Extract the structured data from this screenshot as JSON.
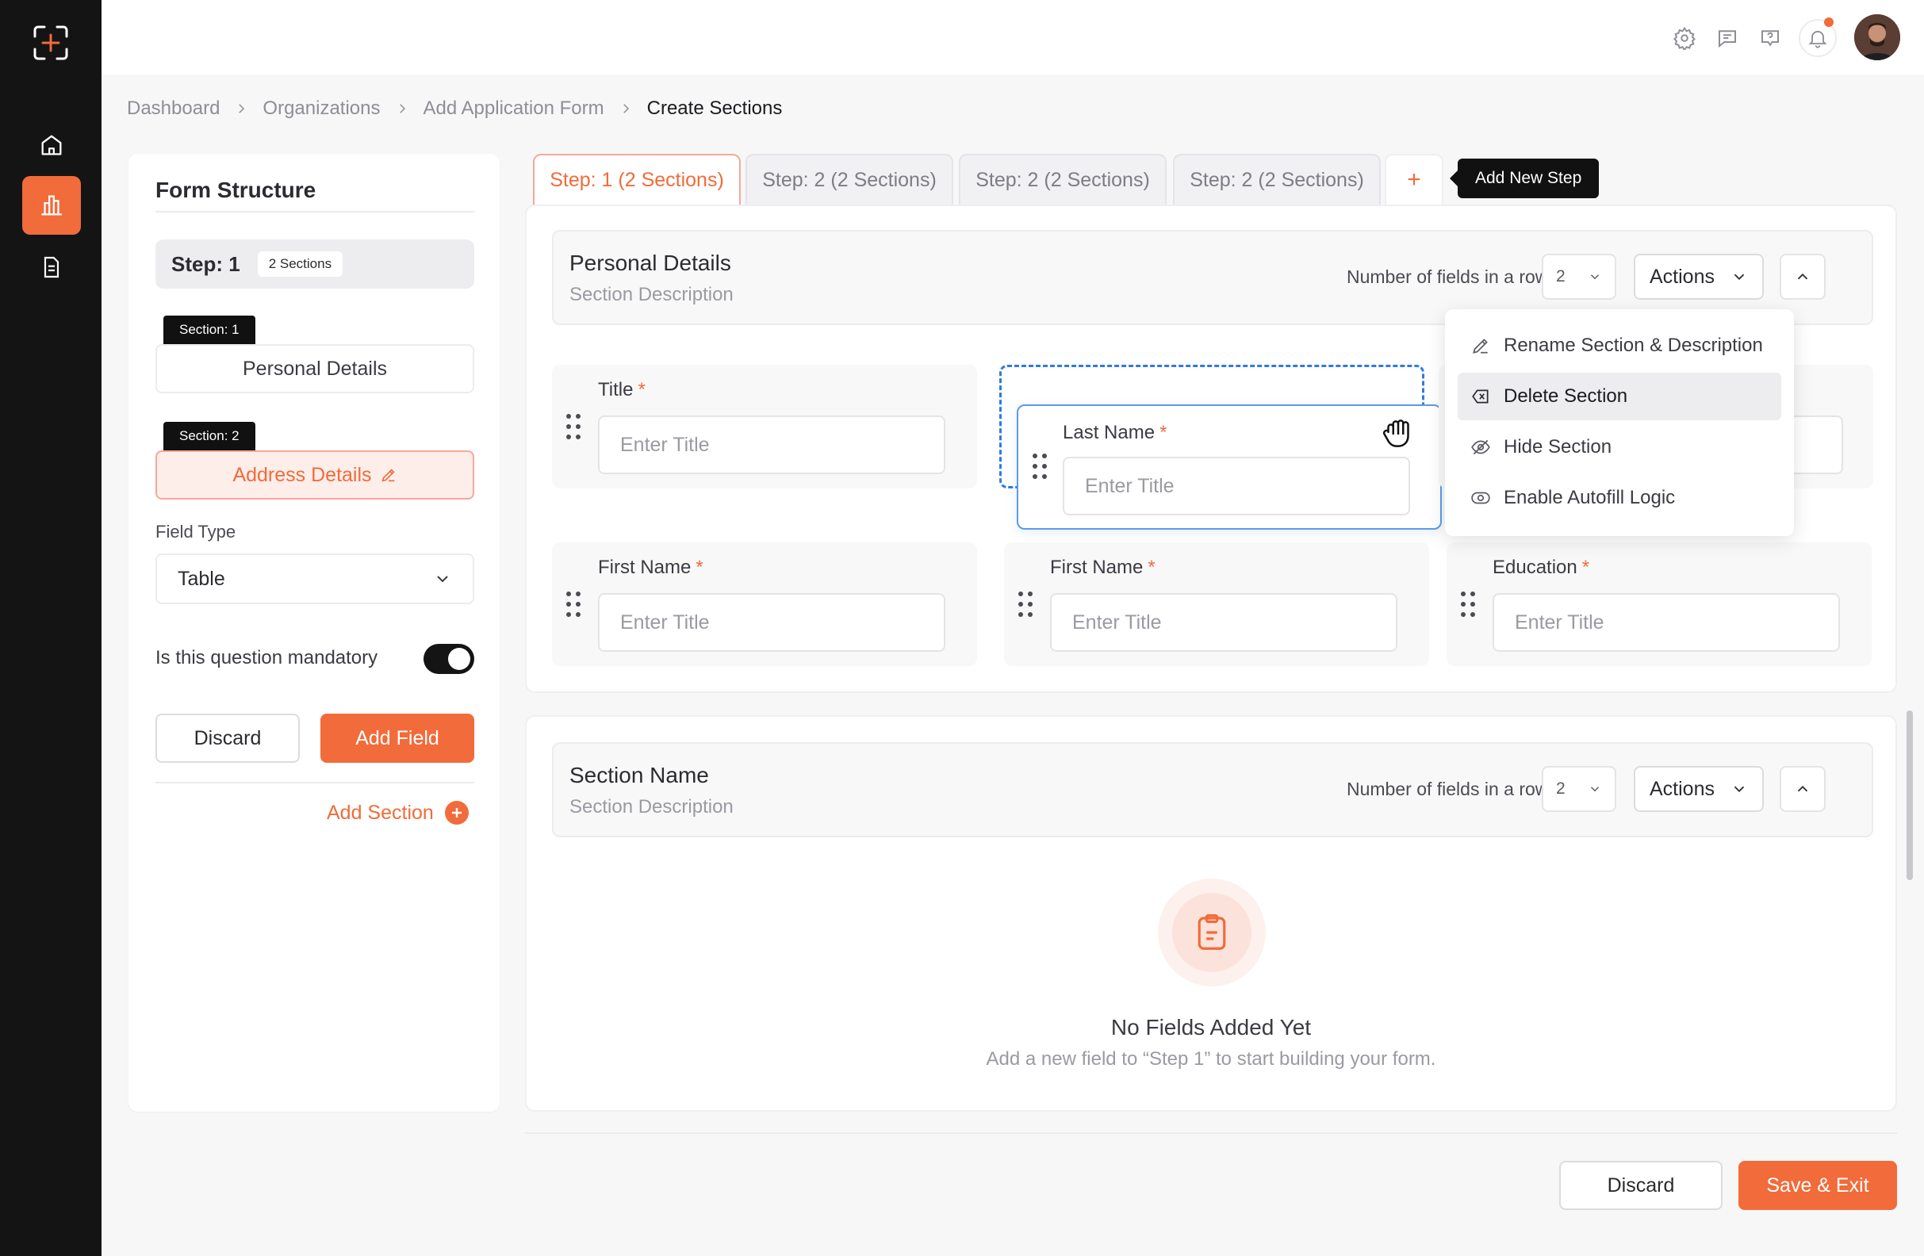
{
  "breadcrumb": [
    "Dashboard",
    "Organizations",
    "Add Application Form",
    "Create Sections"
  ],
  "left_panel": {
    "title": "Form Structure",
    "step_label": "Step: 1",
    "step_pill": "2 Sections",
    "sections": [
      {
        "tag": "Section: 1",
        "name": "Personal Details"
      },
      {
        "tag": "Section: 2",
        "name": "Address Details"
      }
    ],
    "field_type_label": "Field Type",
    "field_type_value": "Table",
    "mandatory_label": "Is this question mandatory",
    "mandatory_on": true,
    "discard_label": "Discard",
    "add_field_label": "Add Field",
    "add_section_label": "Add Section"
  },
  "tabs": [
    "Step: 1 (2 Sections)",
    "Step: 2 (2 Sections)",
    "Step: 2 (2 Sections)",
    "Step: 2 (2 Sections)"
  ],
  "add_tab_symbol": "+",
  "tooltip": "Add New Step",
  "section1": {
    "name": "Personal Details",
    "description": "Section Description",
    "fields_per_row_label": "Number of fields in a row",
    "fields_per_row": "2",
    "actions_label": "Actions",
    "fields": [
      {
        "label": "Title",
        "placeholder": "Enter Title"
      },
      {
        "label": "Last Name",
        "placeholder": "Enter Title"
      },
      {
        "label": "First Name",
        "placeholder": "Enter Title"
      },
      {
        "label": "First Name",
        "placeholder": "Enter Title"
      },
      {
        "label": "Education",
        "placeholder": "Enter Title"
      }
    ],
    "required_mark": "*"
  },
  "actions_menu": [
    "Rename Section & Description",
    "Delete Section",
    "Hide Section",
    "Enable Autofill Logic"
  ],
  "section2": {
    "name": "Section Name",
    "description": "Section Description",
    "fields_per_row_label": "Number of fields in a row",
    "fields_per_row": "2",
    "actions_label": "Actions",
    "empty_title": "No Fields Added Yet",
    "empty_text": "Add a new field to “Step 1” to start building your form."
  },
  "footer": {
    "discard_label": "Discard",
    "save_label": "Save & Exit"
  },
  "colors": {
    "accent": "#f26b3a",
    "sidebar": "#141414",
    "drag_outline": "#2f7be0"
  }
}
